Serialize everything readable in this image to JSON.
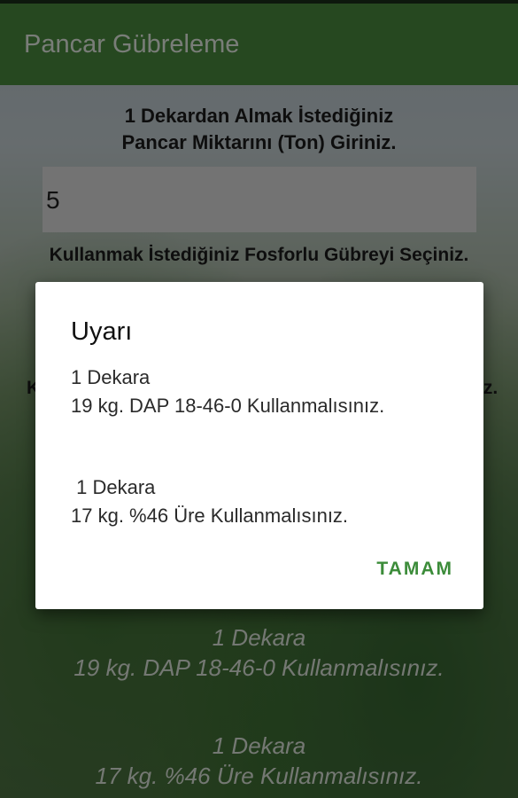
{
  "app_bar": {
    "title": "Pancar Gübreleme"
  },
  "form": {
    "prompt_line1": "1 Dekardan Almak İstediğiniz",
    "prompt_line2": "Pancar Miktarını (Ton) Giriniz.",
    "ton_value": "5",
    "phosphorus_label": "Kullanmak İstediğiniz Fosforlu Gübreyi Seçiniz.",
    "hidden_label_start": "K",
    "hidden_label_end": "iz."
  },
  "results": {
    "dap_line1": "1 Dekara",
    "dap_line2": "19 kg. DAP 18-46-0 Kullanmalısınız.",
    "urea_line1": "1 Dekara",
    "urea_line2": "17 kg. %46 Üre Kullanmalısınız."
  },
  "dialog": {
    "title": "Uyarı",
    "message_1": "1 Dekara\n19 kg. DAP 18-46-0 Kullanmalısınız.",
    "message_2": " 1 Dekara\n17 kg. %46 Üre Kullanmalısınız.",
    "ok_label": "TAMAM"
  },
  "colors": {
    "app_bar": "#4a8a3f",
    "accent": "#3c8c3a"
  }
}
